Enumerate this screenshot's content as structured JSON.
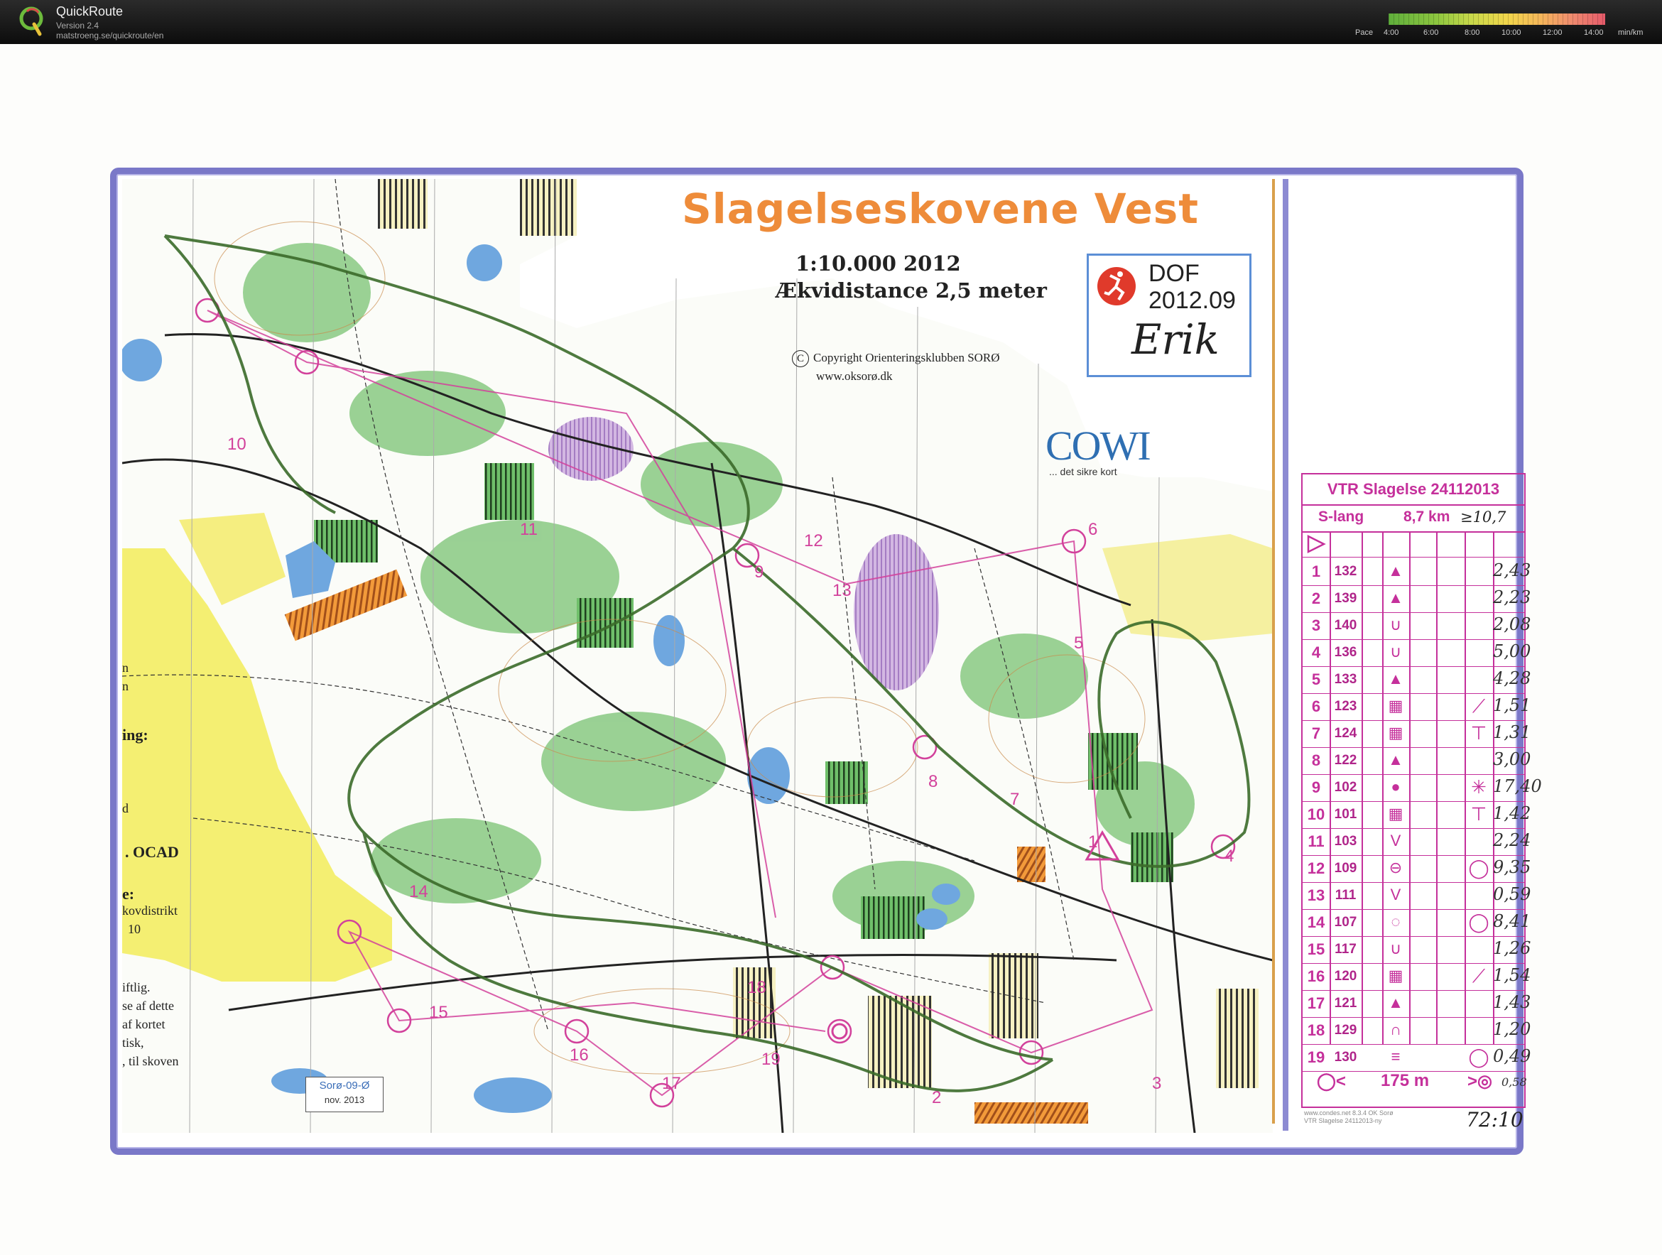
{
  "app": {
    "name": "QuickRoute",
    "version": "Version 2.4",
    "url": "matstroeng.se/quickroute/en"
  },
  "pace_scale": {
    "label": "Pace",
    "ticks": [
      "4:00",
      "6:00",
      "8:00",
      "10:00",
      "12:00",
      "14:00"
    ],
    "unit": "min/km",
    "colors": [
      "#5fae3c",
      "#8cc63f",
      "#f2d64b",
      "#f5b75a",
      "#e65a6a"
    ]
  },
  "map": {
    "title": "Slagelseskovene Vest",
    "scale": "1:10.000 2012",
    "equidistance": "Ækvidistance 2,5 meter",
    "copyright": "Copyright Orienteringsklubben SORØ",
    "website": "www.oksorø.dk",
    "dof": {
      "name": "DOF",
      "year": "2012.09",
      "signature": "Erik"
    },
    "sponsor": {
      "name": "COWI",
      "tagline": "... det sikre kort"
    },
    "stamp": {
      "line1": "Sorø-09-Ø",
      "line2": "nov. 2013"
    },
    "legend_fragments": [
      "n",
      "n",
      "ing:",
      "d",
      ". OCAD",
      "e:",
      "kovdistrikt",
      "10",
      "iftlig.",
      "se af dette",
      "af kortet",
      "tisk,",
      ", til skoven"
    ],
    "control_labels": [
      "1",
      "2",
      "3",
      "4",
      "5",
      "6",
      "7",
      "8",
      "9",
      "10",
      "11",
      "12",
      "13",
      "14",
      "15",
      "16",
      "17",
      "18",
      "19"
    ],
    "colors": {
      "route": "#3b6b2a",
      "course": "#d2419b",
      "frame": "#7a78c8",
      "title": "#ee8c3a"
    }
  },
  "control_card": {
    "title": "VTR Slagelse 24112013",
    "class": "S-lang",
    "length": "8,7 km",
    "actual_length": "≥10,7",
    "controls": [
      {
        "num": "1",
        "code": "132",
        "symbol": "▲",
        "extra": "",
        "split": "2,43"
      },
      {
        "num": "2",
        "code": "139",
        "symbol": "▲",
        "extra": "",
        "split": "2,23"
      },
      {
        "num": "3",
        "code": "140",
        "symbol": "∪",
        "extra": "",
        "split": "2,08"
      },
      {
        "num": "4",
        "code": "136",
        "symbol": "∪",
        "extra": "",
        "split": "5,00"
      },
      {
        "num": "5",
        "code": "133",
        "symbol": "▲",
        "extra": "",
        "split": "4,28"
      },
      {
        "num": "6",
        "code": "123",
        "symbol": "▦",
        "extra": "⟋",
        "split": "1,51"
      },
      {
        "num": "7",
        "code": "124",
        "symbol": "▦",
        "extra": "⊤",
        "split": "1,31"
      },
      {
        "num": "8",
        "code": "122",
        "symbol": "▲",
        "extra": "",
        "split": "3,00"
      },
      {
        "num": "9",
        "code": "102",
        "symbol": "●",
        "extra": "✳",
        "split": "17,40"
      },
      {
        "num": "10",
        "code": "101",
        "symbol": "▦",
        "extra": "⊤",
        "split": "1,42"
      },
      {
        "num": "11",
        "code": "103",
        "symbol": "V",
        "extra": "",
        "split": "2,24"
      },
      {
        "num": "12",
        "code": "109",
        "symbol": "⊖",
        "extra": "◯",
        "split": "9,35"
      },
      {
        "num": "13",
        "code": "111",
        "symbol": "V",
        "extra": "",
        "split": "0,59"
      },
      {
        "num": "14",
        "code": "107",
        "symbol": "◌",
        "extra": "◯",
        "split": "8,41"
      },
      {
        "num": "15",
        "code": "117",
        "symbol": "∪",
        "extra": "",
        "split": "1,26"
      },
      {
        "num": "16",
        "code": "120",
        "symbol": "▦",
        "extra": "⟋",
        "split": "1,54"
      },
      {
        "num": "17",
        "code": "121",
        "symbol": "▲",
        "extra": "",
        "split": "1,43"
      },
      {
        "num": "18",
        "code": "129",
        "symbol": "∩",
        "extra": "",
        "split": "1,20"
      },
      {
        "num": "19",
        "code": "130",
        "symbol": "≡",
        "extra": "◯",
        "split": "0,49"
      }
    ],
    "finish_distance": "175 m",
    "finish_split": "0,58",
    "footer": [
      "www.condes.net 8.3.4 OK Sorø",
      "VTR Slagelse 24112013-ny"
    ],
    "total_time": "72:10"
  }
}
